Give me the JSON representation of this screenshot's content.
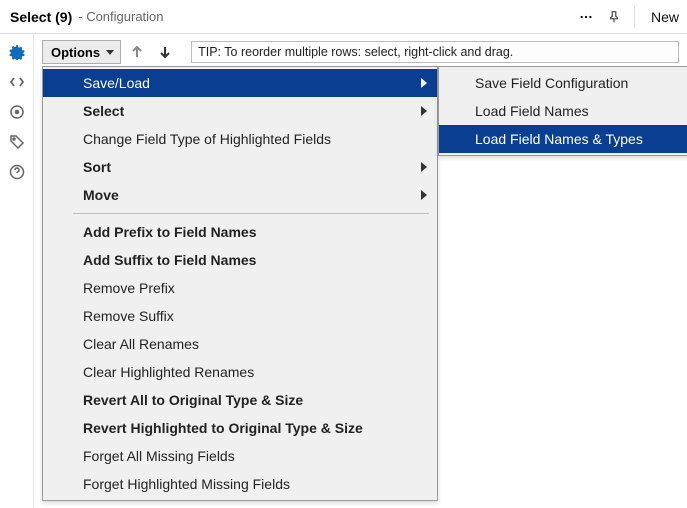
{
  "window": {
    "title": "Select (9)",
    "subtitle": "- Configuration",
    "new_label": "New"
  },
  "toolbar": {
    "options_label": "Options",
    "tip": "TIP: To reorder multiple rows: select, right-click and drag."
  },
  "menu": {
    "items": [
      {
        "label": "Save/Load",
        "bold": false,
        "submenu": true,
        "highlight": true
      },
      {
        "label": "Select",
        "bold": true,
        "submenu": true
      },
      {
        "label": "Change Field Type of Highlighted Fields",
        "bold": false
      },
      {
        "label": "Sort",
        "bold": true,
        "submenu": true
      },
      {
        "label": "Move",
        "bold": true,
        "submenu": true
      },
      {
        "separator": true
      },
      {
        "label": "Add Prefix to Field Names",
        "bold": true
      },
      {
        "label": "Add Suffix to Field Names",
        "bold": true
      },
      {
        "label": "Remove Prefix",
        "bold": false
      },
      {
        "label": "Remove Suffix",
        "bold": false
      },
      {
        "label": "Clear All Renames",
        "bold": false
      },
      {
        "label": "Clear Highlighted Renames",
        "bold": false
      },
      {
        "label": "Revert All to Original Type & Size",
        "bold": true
      },
      {
        "label": "Revert Highlighted to Original Type & Size",
        "bold": true
      },
      {
        "label": "Forget All Missing Fields",
        "bold": false
      },
      {
        "label": "Forget Highlighted Missing Fields",
        "bold": false
      }
    ]
  },
  "submenu": {
    "items": [
      {
        "label": "Save Field Configuration"
      },
      {
        "label": "Load Field Names"
      },
      {
        "label": "Load Field Names & Types",
        "highlight": true
      }
    ]
  }
}
